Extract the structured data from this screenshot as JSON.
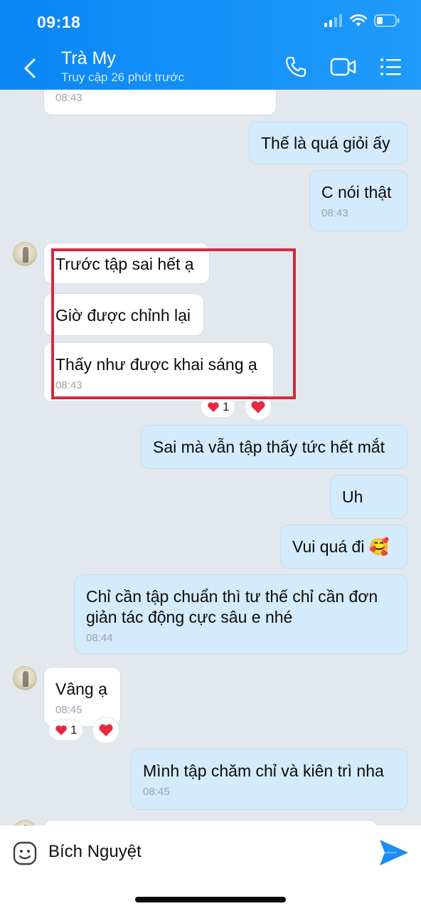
{
  "status_bar": {
    "time": "09:18"
  },
  "header": {
    "contact_name": "Trà My",
    "last_seen": "Truy cập 26 phút trước"
  },
  "messages": [
    {
      "direction": "in",
      "text": "",
      "time": "08:43"
    },
    {
      "direction": "out",
      "text": "Thế là quá giỏi ấy",
      "time": ""
    },
    {
      "direction": "out",
      "text": "C nói thật",
      "time": "08:43"
    },
    {
      "direction": "in",
      "text": "Trước tập sai hết ạ",
      "time": ""
    },
    {
      "direction": "in",
      "text": "Giờ được chỉnh lại",
      "time": ""
    },
    {
      "direction": "in",
      "text": "Thấy như được khai sáng ạ",
      "time": "08:43",
      "reaction_count": "1"
    },
    {
      "direction": "out",
      "text": "Sai mà vẫn tập thấy tức hết mắt",
      "time": ""
    },
    {
      "direction": "out",
      "text": "Uh",
      "time": ""
    },
    {
      "direction": "out",
      "text": "Vui quá đi 🥰",
      "time": ""
    },
    {
      "direction": "out",
      "text_line1": "Chỉ cần tập chuẩn thì tư thế chỉ cần đơn",
      "text_line2": "giản tác động cực sâu e nhé",
      "time": "08:44"
    },
    {
      "direction": "in",
      "text": "Vâng ạ",
      "time": "08:45",
      "reaction_count": "1"
    },
    {
      "direction": "out",
      "text": "Mình tập chăm chỉ và kiên trì nha",
      "time": "08:45"
    }
  ],
  "composer": {
    "value": "Bích Nguyệt"
  },
  "colors": {
    "header": "#0a86f5",
    "outgoing": "#d4ebfb",
    "incoming": "#ffffff",
    "highlight": "#d6293e",
    "send": "#1a8cf2"
  }
}
